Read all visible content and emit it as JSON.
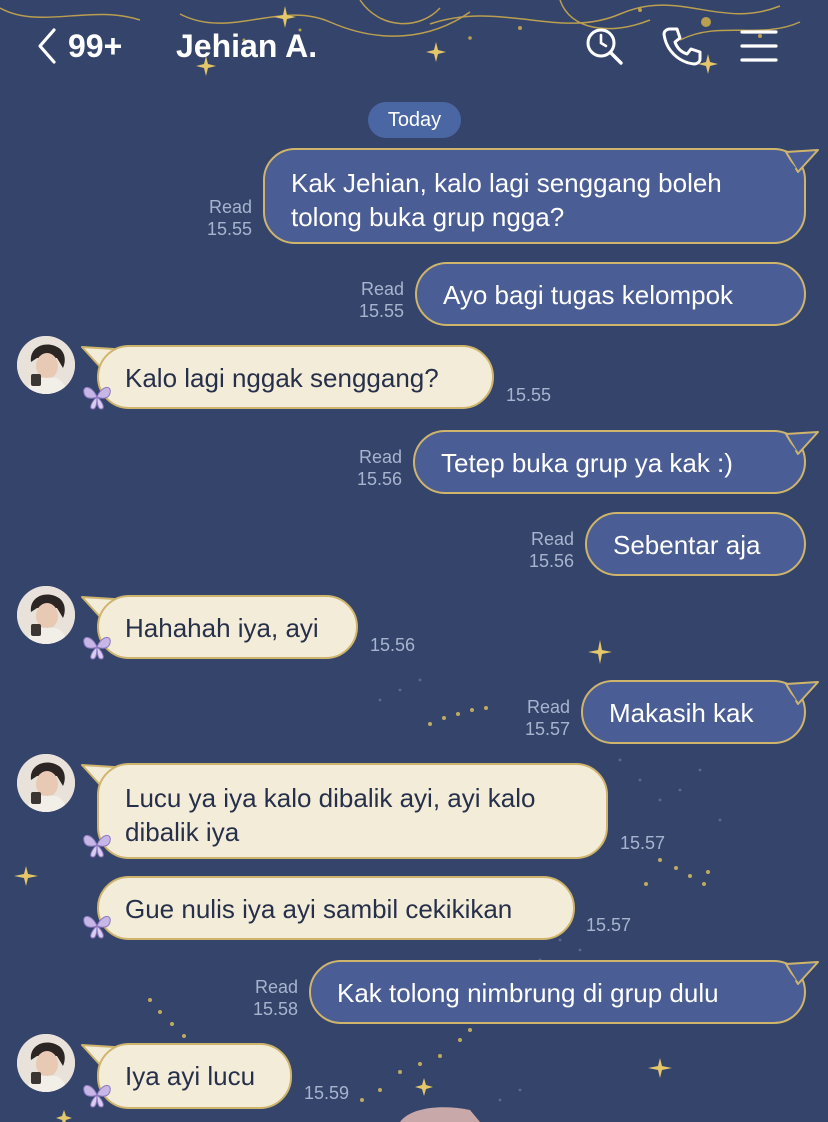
{
  "header": {
    "unread_count": "99+",
    "contact_name": "Jehian A."
  },
  "date_separator": "Today",
  "colors": {
    "background": "#35446a",
    "outgoing_bubble": "#4a5d94",
    "incoming_bubble": "#f3ecd9",
    "bubble_border": "#cfb56c",
    "date_chip": "#4a67a3"
  },
  "icons": [
    "chevron-left-icon",
    "search-icon",
    "phone-icon",
    "menu-icon",
    "butterfly-icon"
  ],
  "messages": [
    {
      "direction": "outgoing",
      "text": "Kak Jehian, kalo lagi senggang boleh tolong buka grup ngga?",
      "status": "Read",
      "time": "15.55"
    },
    {
      "direction": "outgoing",
      "text": "Ayo bagi tugas kelompok",
      "status": "Read",
      "time": "15.55"
    },
    {
      "direction": "incoming",
      "text": "Kalo lagi nggak senggang?",
      "time": "15.55"
    },
    {
      "direction": "outgoing",
      "text": "Tetep buka grup ya kak :)",
      "status": "Read",
      "time": "15.56"
    },
    {
      "direction": "outgoing",
      "text": "Sebentar aja",
      "status": "Read",
      "time": "15.56"
    },
    {
      "direction": "incoming",
      "text": "Hahahah iya, ayi",
      "time": "15.56"
    },
    {
      "direction": "outgoing",
      "text": "Makasih kak",
      "status": "Read",
      "time": "15.57"
    },
    {
      "direction": "incoming",
      "text": "Lucu ya iya kalo dibalik ayi, ayi kalo dibalik iya",
      "time": "15.57"
    },
    {
      "direction": "incoming",
      "text": "Gue nulis iya ayi sambil cekikikan",
      "time": "15.57"
    },
    {
      "direction": "outgoing",
      "text": "Kak tolong nimbrung di grup dulu",
      "status": "Read",
      "time": "15.58"
    },
    {
      "direction": "incoming",
      "text": "Iya ayi lucu",
      "time": "15.59"
    }
  ]
}
